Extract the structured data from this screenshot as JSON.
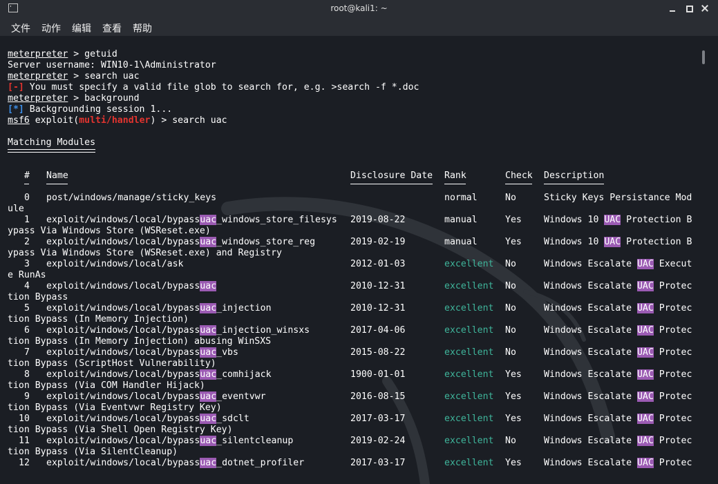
{
  "window": {
    "title": "root@kali1: ~"
  },
  "menu": [
    "文件",
    "动作",
    "编辑",
    "查看",
    "帮助"
  ],
  "terminal": {
    "prompt_meterpreter": "meterpreter",
    "prompt_msf": "msf6",
    "cmd_getuid": " > getuid",
    "server_username": "Server username: WIN10-1\\Administrator",
    "cmd_search": " > search uac",
    "err_tag": "[-]",
    "err_msg": " You must specify a valid file glob to search for, e.g. >search -f *.doc",
    "cmd_background": " > background",
    "info_tag": "[*]",
    "info_msg": " Backgrounding session 1...",
    "exploit_prefix": " exploit(",
    "module": "multi/handler",
    "exploit_suffix": ") > search uac",
    "matching_title": "Matching Modules",
    "headers": {
      "num": "#",
      "name": "Name",
      "date": "Disclosure Date",
      "rank": "Rank",
      "check": "Check",
      "desc": "Description"
    },
    "rows": [
      {
        "num": "0",
        "name_pre": "post/windows/manage/sticky_keys",
        "name_hl": "",
        "name_post": "",
        "cont": "ule",
        "date": "",
        "rank": "normal",
        "check": "No",
        "desc_pre": "Sticky Keys Persistance Mod",
        "desc_hl": "",
        "desc_post": ""
      },
      {
        "num": "1",
        "name_pre": "exploit/windows/local/bypass",
        "name_hl": "uac",
        "name_post": "_windows_store_filesys",
        "cont": "ypass Via Windows Store (WSReset.exe)",
        "date": "2019-08-22",
        "rank": "manual",
        "check": "Yes",
        "desc_pre": "Windows 10 ",
        "desc_hl": "UAC",
        "desc_post": " Protection B"
      },
      {
        "num": "2",
        "name_pre": "exploit/windows/local/bypass",
        "name_hl": "uac",
        "name_post": "_windows_store_reg",
        "cont": "ypass Via Windows Store (WSReset.exe) and Registry",
        "date": "2019-02-19",
        "rank": "manual",
        "check": "Yes",
        "desc_pre": "Windows 10 ",
        "desc_hl": "UAC",
        "desc_post": " Protection B"
      },
      {
        "num": "3",
        "name_pre": "exploit/windows/local/ask",
        "name_hl": "",
        "name_post": "",
        "cont": "e RunAs",
        "date": "2012-01-03",
        "rank": "excellent",
        "check": "No",
        "desc_pre": "Windows Escalate ",
        "desc_hl": "UAC",
        "desc_post": " Execut"
      },
      {
        "num": "4",
        "name_pre": "exploit/windows/local/bypass",
        "name_hl": "uac",
        "name_post": "",
        "cont": "tion Bypass",
        "date": "2010-12-31",
        "rank": "excellent",
        "check": "No",
        "desc_pre": "Windows Escalate ",
        "desc_hl": "UAC",
        "desc_post": " Protec"
      },
      {
        "num": "5",
        "name_pre": "exploit/windows/local/bypass",
        "name_hl": "uac",
        "name_post": "_injection",
        "cont": "tion Bypass (In Memory Injection)",
        "date": "2010-12-31",
        "rank": "excellent",
        "check": "No",
        "desc_pre": "Windows Escalate ",
        "desc_hl": "UAC",
        "desc_post": " Protec"
      },
      {
        "num": "6",
        "name_pre": "exploit/windows/local/bypass",
        "name_hl": "uac",
        "name_post": "_injection_winsxs",
        "cont": "tion Bypass (In Memory Injection) abusing WinSXS",
        "date": "2017-04-06",
        "rank": "excellent",
        "check": "No",
        "desc_pre": "Windows Escalate ",
        "desc_hl": "UAC",
        "desc_post": " Protec"
      },
      {
        "num": "7",
        "name_pre": "exploit/windows/local/bypass",
        "name_hl": "uac",
        "name_post": "_vbs",
        "cont": "tion Bypass (ScriptHost Vulnerability)",
        "date": "2015-08-22",
        "rank": "excellent",
        "check": "No",
        "desc_pre": "Windows Escalate ",
        "desc_hl": "UAC",
        "desc_post": " Protec"
      },
      {
        "num": "8",
        "name_pre": "exploit/windows/local/bypass",
        "name_hl": "uac",
        "name_post": "_comhijack",
        "cont": "tion Bypass (Via COM Handler Hijack)",
        "date": "1900-01-01",
        "rank": "excellent",
        "check": "Yes",
        "desc_pre": "Windows Escalate ",
        "desc_hl": "UAC",
        "desc_post": " Protec"
      },
      {
        "num": "9",
        "name_pre": "exploit/windows/local/bypass",
        "name_hl": "uac",
        "name_post": "_eventvwr",
        "cont": "tion Bypass (Via Eventvwr Registry Key)",
        "date": "2016-08-15",
        "rank": "excellent",
        "check": "Yes",
        "desc_pre": "Windows Escalate ",
        "desc_hl": "UAC",
        "desc_post": " Protec"
      },
      {
        "num": "10",
        "name_pre": "exploit/windows/local/bypass",
        "name_hl": "uac",
        "name_post": "_sdclt",
        "cont": "tion Bypass (Via Shell Open Registry Key)",
        "date": "2017-03-17",
        "rank": "excellent",
        "check": "Yes",
        "desc_pre": "Windows Escalate ",
        "desc_hl": "UAC",
        "desc_post": " Protec"
      },
      {
        "num": "11",
        "name_pre": "exploit/windows/local/bypass",
        "name_hl": "uac",
        "name_post": "_silentcleanup",
        "cont": "tion Bypass (Via SilentCleanup)",
        "date": "2019-02-24",
        "rank": "excellent",
        "check": "No",
        "desc_pre": "Windows Escalate ",
        "desc_hl": "UAC",
        "desc_post": " Protec"
      },
      {
        "num": "12",
        "name_pre": "exploit/windows/local/bypass",
        "name_hl": "uac",
        "name_post": "_dotnet_profiler",
        "cont": "",
        "date": "2017-03-17",
        "rank": "excellent",
        "check": "Yes",
        "desc_pre": "Windows Escalate ",
        "desc_hl": "UAC",
        "desc_post": " Protec"
      }
    ]
  },
  "colors": {
    "background": "#1b1e24",
    "titlebar": "#2a2d33",
    "error": "#e3342f",
    "info": "#3d8fe8",
    "excellent": "#3fb59b",
    "highlight": "#9b5bb3"
  }
}
